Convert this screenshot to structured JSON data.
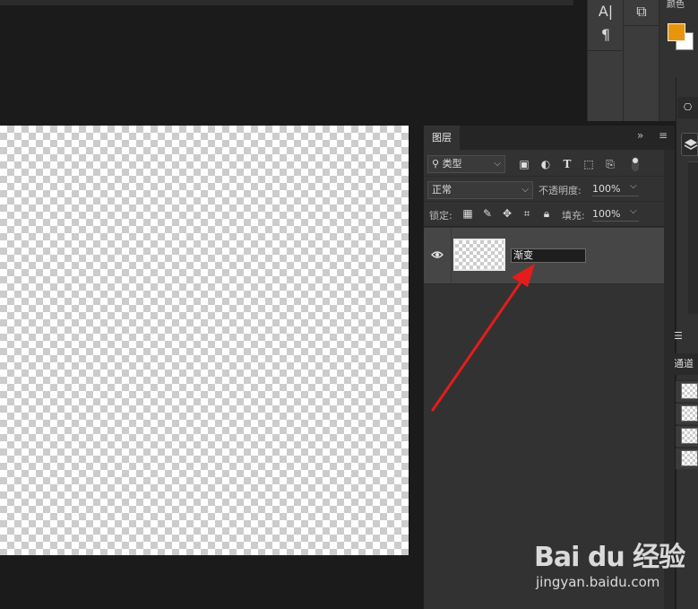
{
  "right_toolbar": {
    "color_label": "颜色",
    "foreground_color": "#e8950c",
    "background_color": "#ffffff"
  },
  "layers_panel": {
    "tab_label": "图层",
    "filter": {
      "label": "类型"
    },
    "blend_mode": "正常",
    "opacity_label": "不透明度:",
    "opacity_value": "100%",
    "lock_label": "锁定:",
    "fill_label": "填充:",
    "fill_value": "100%",
    "layers": [
      {
        "name_input_value": "渐变"
      }
    ]
  },
  "side_panel": {
    "tab_partial": "通道"
  },
  "watermark": {
    "logo": "Bai du 经验",
    "url": "jingyan.baidu.com"
  },
  "annotation": {
    "arrow_color": "#e41c1c"
  }
}
